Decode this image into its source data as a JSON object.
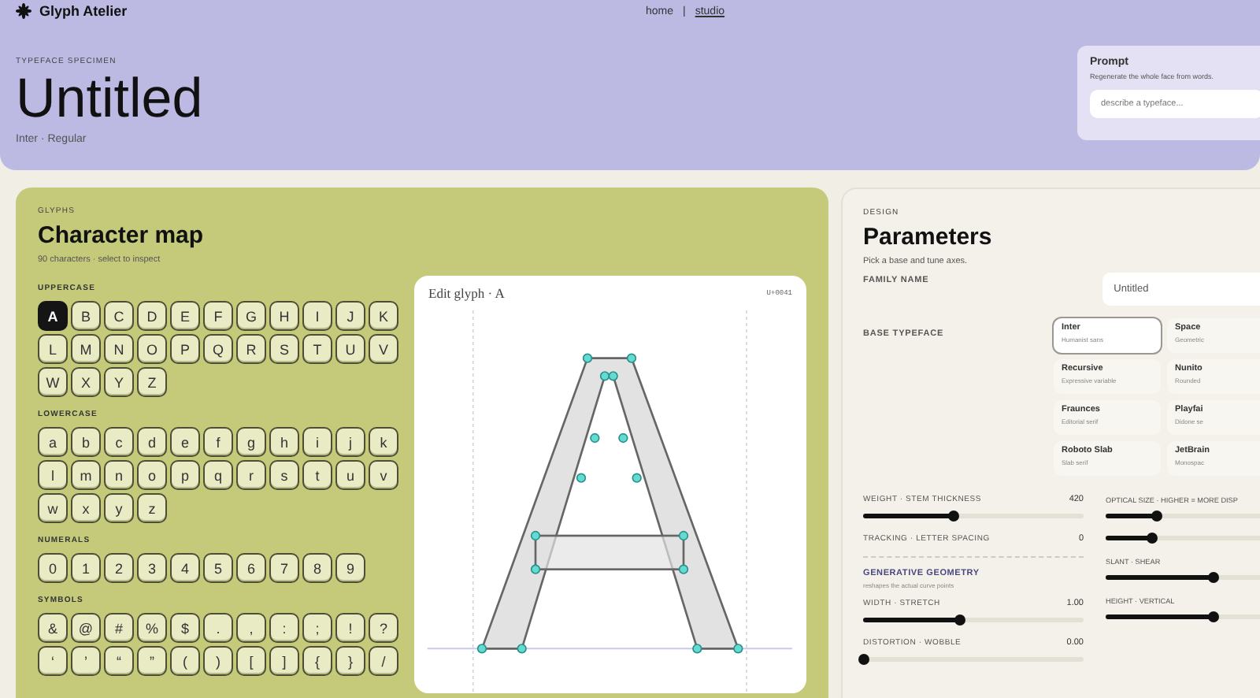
{
  "nav": {
    "brand": "Glyph Atelier",
    "separator": "|",
    "links": [
      {
        "label": "home",
        "selected": false
      },
      {
        "label": "studio",
        "selected": true
      }
    ]
  },
  "hero": {
    "eyebrow": "TYPEFACE SPECIMEN",
    "title": "Untitled",
    "meta": "Inter · Regular"
  },
  "prompt": {
    "title": "Prompt",
    "note": "Regenerate the whole face from words.",
    "placeholder": "describe a typeface..."
  },
  "glyphs": {
    "eyebrow": "GLYPHS",
    "title": "Character map",
    "subtitle": "90 characters · select to inspect",
    "groups": [
      {
        "label": "UPPERCASE",
        "keys": [
          {
            "char": "A",
            "selected": true
          },
          {
            "char": "B",
            "selected": false
          },
          {
            "char": "C",
            "selected": false
          },
          {
            "char": "D",
            "selected": false
          },
          {
            "char": "E",
            "selected": false
          },
          {
            "char": "F",
            "selected": false
          },
          {
            "char": "G",
            "selected": false
          },
          {
            "char": "H",
            "selected": false
          },
          {
            "char": "I",
            "selected": false
          },
          {
            "char": "J",
            "selected": false
          },
          {
            "char": "K",
            "selected": false
          },
          {
            "char": "L",
            "selected": false
          },
          {
            "char": "M",
            "selected": false
          },
          {
            "char": "N",
            "selected": false
          },
          {
            "char": "O",
            "selected": false
          },
          {
            "char": "P",
            "selected": false
          },
          {
            "char": "Q",
            "selected": false
          },
          {
            "char": "R",
            "selected": false
          },
          {
            "char": "S",
            "selected": false
          },
          {
            "char": "T",
            "selected": false
          },
          {
            "char": "U",
            "selected": false
          },
          {
            "char": "V",
            "selected": false
          },
          {
            "char": "W",
            "selected": false
          },
          {
            "char": "X",
            "selected": false
          },
          {
            "char": "Y",
            "selected": false
          },
          {
            "char": "Z",
            "selected": false
          }
        ]
      },
      {
        "label": "LOWERCASE",
        "keys": [
          {
            "char": "a",
            "selected": false
          },
          {
            "char": "b",
            "selected": false
          },
          {
            "char": "c",
            "selected": false
          },
          {
            "char": "d",
            "selected": false
          },
          {
            "char": "e",
            "selected": false
          },
          {
            "char": "f",
            "selected": false
          },
          {
            "char": "g",
            "selected": false
          },
          {
            "char": "h",
            "selected": false
          },
          {
            "char": "i",
            "selected": false
          },
          {
            "char": "j",
            "selected": false
          },
          {
            "char": "k",
            "selected": false
          },
          {
            "char": "l",
            "selected": false
          },
          {
            "char": "m",
            "selected": false
          },
          {
            "char": "n",
            "selected": false
          },
          {
            "char": "o",
            "selected": false
          },
          {
            "char": "p",
            "selected": false
          },
          {
            "char": "q",
            "selected": false
          },
          {
            "char": "r",
            "selected": false
          },
          {
            "char": "s",
            "selected": false
          },
          {
            "char": "t",
            "selected": false
          },
          {
            "char": "u",
            "selected": false
          },
          {
            "char": "v",
            "selected": false
          },
          {
            "char": "w",
            "selected": false
          },
          {
            "char": "x",
            "selected": false
          },
          {
            "char": "y",
            "selected": false
          },
          {
            "char": "z",
            "selected": false
          }
        ]
      },
      {
        "label": "NUMERALS",
        "keys": [
          {
            "char": "0",
            "selected": false
          },
          {
            "char": "1",
            "selected": false
          },
          {
            "char": "2",
            "selected": false
          },
          {
            "char": "3",
            "selected": false
          },
          {
            "char": "4",
            "selected": false
          },
          {
            "char": "5",
            "selected": false
          },
          {
            "char": "6",
            "selected": false
          },
          {
            "char": "7",
            "selected": false
          },
          {
            "char": "8",
            "selected": false
          },
          {
            "char": "9",
            "selected": false
          }
        ]
      },
      {
        "label": "SYMBOLS",
        "keys": [
          {
            "char": "&",
            "selected": false
          },
          {
            "char": "@",
            "selected": false
          },
          {
            "char": "#",
            "selected": false
          },
          {
            "char": "%",
            "selected": false
          },
          {
            "char": "$",
            "selected": false
          },
          {
            "char": ".",
            "selected": false
          },
          {
            "char": ",",
            "selected": false
          },
          {
            "char": ":",
            "selected": false
          },
          {
            "char": ";",
            "selected": false
          },
          {
            "char": "!",
            "selected": false
          },
          {
            "char": "?",
            "selected": false
          },
          {
            "char": "‘",
            "selected": false
          },
          {
            "char": "’",
            "selected": false
          },
          {
            "char": "“",
            "selected": false
          },
          {
            "char": "”",
            "selected": false
          },
          {
            "char": "(",
            "selected": false
          },
          {
            "char": ")",
            "selected": false
          },
          {
            "char": "[",
            "selected": false
          },
          {
            "char": "]",
            "selected": false
          },
          {
            "char": "{",
            "selected": false
          },
          {
            "char": "}",
            "selected": false
          },
          {
            "char": "/",
            "selected": false
          }
        ]
      }
    ]
  },
  "editor": {
    "title": "Edit glyph · A",
    "code": "U+0041"
  },
  "design": {
    "eyebrow": "DESIGN",
    "title": "Parameters",
    "subtitle": "Pick a base and tune axes.",
    "family_name": {
      "label": "FAMILY NAME",
      "value": "Untitled"
    },
    "base_typeface": {
      "label": "BASE TYPEFACE",
      "options": [
        {
          "name": "Inter",
          "note": "Humanist sans",
          "selected": true
        },
        {
          "name": "Space",
          "note": "Geometric",
          "selected": false
        },
        {
          "name": "Recursive",
          "note": "Expressive variable",
          "selected": false
        },
        {
          "name": "Nunito",
          "note": "Rounded",
          "selected": false
        },
        {
          "name": "Fraunces",
          "note": "Editorial serif",
          "selected": false
        },
        {
          "name": "Playfai",
          "note": "Didone se",
          "selected": false
        },
        {
          "name": "Roboto Slab",
          "note": "Slab serif",
          "selected": false
        },
        {
          "name": "JetBrain",
          "note": "Monospac",
          "selected": false
        }
      ]
    },
    "axes_left": [
      {
        "kind": "slider",
        "label": "WEIGHT · STEM THICKNESS",
        "value": "420",
        "level": 0.41
      },
      {
        "kind": "reading",
        "label": "TRACKING · LETTER SPACING",
        "value": "0"
      },
      {
        "kind": "section",
        "title": "GENERATIVE GEOMETRY",
        "note": "reshapes the actual curve points"
      },
      {
        "kind": "slider",
        "label": "WIDTH · STRETCH",
        "value": "1.00",
        "level": 0.44
      },
      {
        "kind": "slider",
        "label": "DISTORTION · WOBBLE",
        "value": "0.00",
        "level": 0
      }
    ],
    "axes_right": [
      {
        "kind": "slider",
        "label": "OPTICAL SIZE · HIGHER = MORE DISP",
        "level": 0.23
      },
      {
        "kind": "slider",
        "level": 0.21
      },
      {
        "kind": "slider",
        "label": "SLANT · SHEAR",
        "level": 0.49
      },
      {
        "kind": "slider",
        "label": "HEIGHT · VERTICAL",
        "level": 0.49
      }
    ]
  }
}
